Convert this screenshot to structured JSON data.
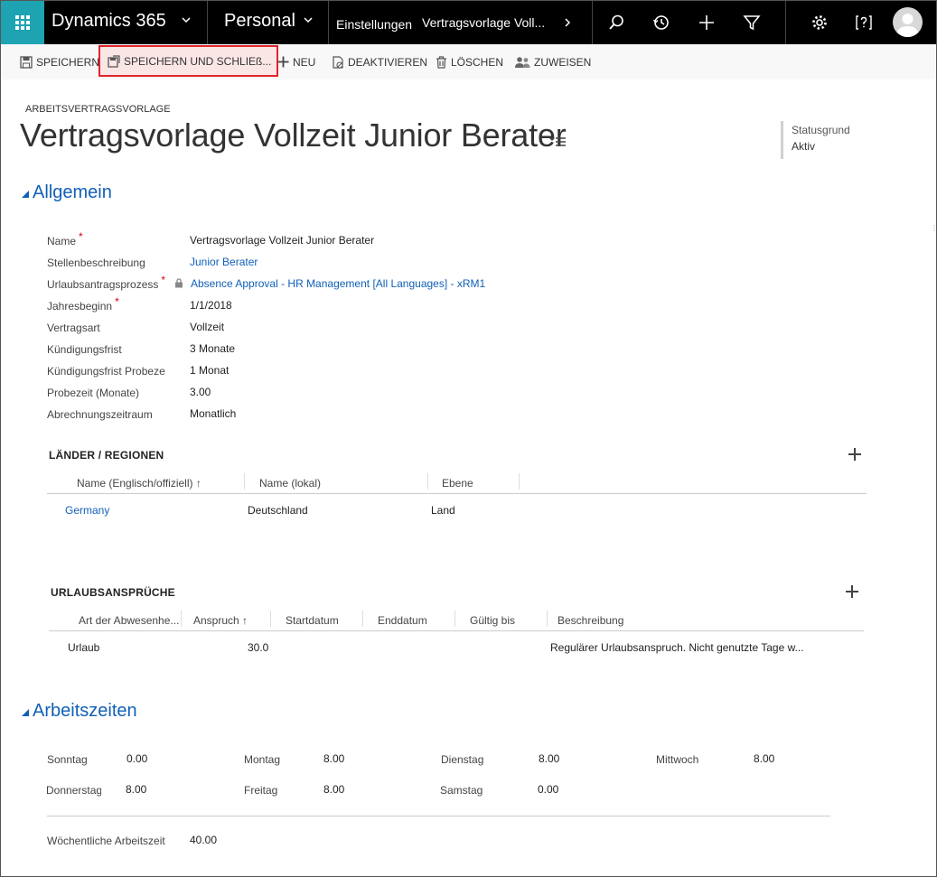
{
  "nav": {
    "brand": "Dynamics 365",
    "area": "Personal",
    "crumb_settings": "Einstellungen",
    "crumb_record": "Vertragsvorlage Voll..."
  },
  "commands": {
    "save": "SPEICHERN",
    "save_close": "SPEICHERN UND SCHLIEß...",
    "new": "NEU",
    "deactivate": "DEAKTIVIEREN",
    "delete": "LÖSCHEN",
    "assign": "ZUWEISEN"
  },
  "header": {
    "entity_type": "ARBEITSVERTRAGSVORLAGE",
    "title": "Vertragsvorlage Vollzeit Junior Berater",
    "status_label": "Statusgrund",
    "status_value": "Aktiv"
  },
  "general": {
    "section_title": "Allgemein",
    "fields": [
      {
        "label": "Name",
        "value": "Vertragsvorlage Vollzeit Junior Berater"
      },
      {
        "label": "Stellenbeschreibung",
        "value": "Junior Berater"
      },
      {
        "label": "Urlaubsantragsprozess",
        "value": "Absence Approval - HR Management [All Languages] - xRM1"
      },
      {
        "label": "Jahresbeginn",
        "value": "1/1/2018"
      },
      {
        "label": "Vertragsart",
        "value": "Vollzeit"
      },
      {
        "label": "Kündigungsfrist",
        "value": "3 Monate"
      },
      {
        "label": "Kündigungsfrist Probeze",
        "value": "1 Monat"
      },
      {
        "label": "Probezeit (Monate)",
        "value": "3.00"
      },
      {
        "label": "Abrechnungszeitraum",
        "value": "Monatlich"
      }
    ],
    "required_mark": "*"
  },
  "countries": {
    "title": "LÄNDER / REGIONEN",
    "columns": [
      "Name (Englisch/offiziell)",
      "Name (lokal)",
      "Ebene"
    ],
    "rows": [
      [
        "Germany",
        "Deutschland",
        "Land"
      ]
    ]
  },
  "leave": {
    "title": "URLAUBSANSPRÜCHE",
    "columns": [
      "Art der Abwesenhe...",
      "Anspruch",
      "Startdatum",
      "Enddatum",
      "Gültig bis",
      "Beschreibung"
    ],
    "rows": [
      [
        "Urlaub",
        "30.0",
        "",
        "",
        "",
        "Regulärer Urlaubsanspruch. Nicht genutzte Tage w..."
      ]
    ]
  },
  "workhours": {
    "section_title": "Arbeitszeiten",
    "days": [
      {
        "label": "Sonntag",
        "value": "0.00"
      },
      {
        "label": "Montag",
        "value": "8.00"
      },
      {
        "label": "Dienstag",
        "value": "8.00"
      },
      {
        "label": "Mittwoch",
        "value": "8.00"
      },
      {
        "label": "Donnerstag",
        "value": "8.00"
      },
      {
        "label": "Freitag",
        "value": "8.00"
      },
      {
        "label": "Samstag",
        "value": "0.00"
      }
    ],
    "weekly_label": "Wöchentliche Arbeitszeit",
    "weekly_value": "40.00"
  },
  "colors": {
    "accent": "#1da3b1",
    "link": "#1160b7",
    "highlight_border": "#e0252b"
  }
}
